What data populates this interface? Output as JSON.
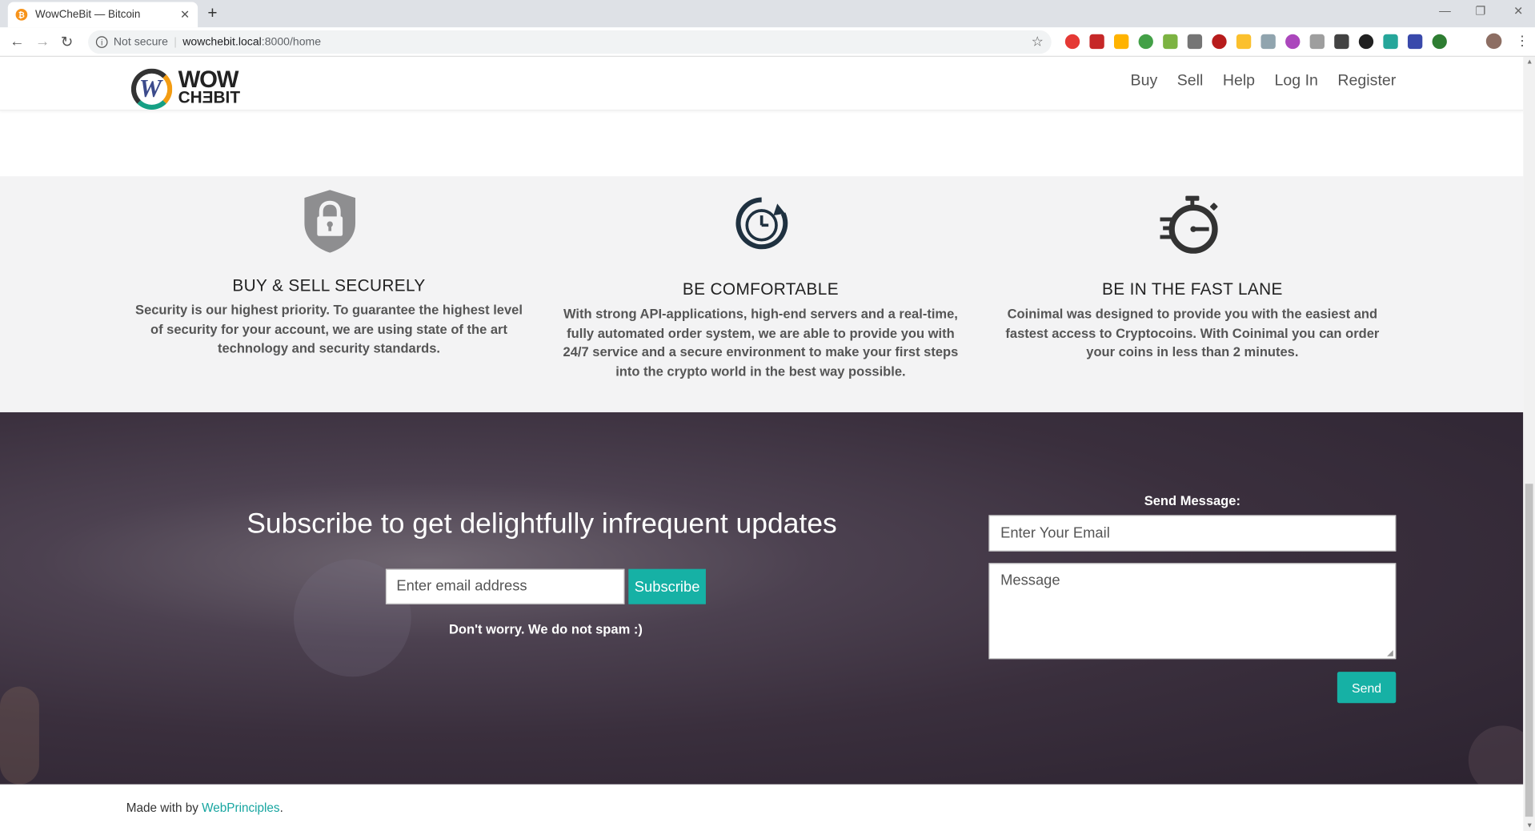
{
  "browser": {
    "tab_title": "WowCheBit — Bitcoin",
    "favicon": "₿",
    "close": "✕",
    "new_tab": "+",
    "minimize": "—",
    "restore": "❐",
    "close_window": "✕",
    "back": "←",
    "forward": "→",
    "reload": "↻",
    "not_secure": "Not secure",
    "separator": "|",
    "url_host": "wowchebit.local",
    "url_path": ":8000/home",
    "bookmark_star": "☆",
    "menu": "⋮",
    "extension_colors": [
      "#e53935",
      "#c62828",
      "#ffb300",
      "#43a047",
      "#7cb342",
      "#757575",
      "#b71c1c",
      "#fbc02d",
      "#90a4ae",
      "#ab47bc",
      "#9e9e9e",
      "#424242",
      "#212121",
      "#26a69a",
      "#3949ab",
      "#2e7d32"
    ]
  },
  "header": {
    "logo_w": "W",
    "logo_line1": "WOW",
    "logo_line2": "CHƎBIT",
    "nav": [
      "Buy",
      "Sell",
      "Help",
      "Log In",
      "Register"
    ]
  },
  "features": [
    {
      "icon": "padlock-shield-icon",
      "title": "BUY & SELL SECURELY",
      "text": "Security is our highest priority. To guarantee the highest level of security for your account, we are using state of the art technology and security standards."
    },
    {
      "icon": "stopwatch-refresh-icon",
      "title": "BE COMFORTABLE",
      "text": "With strong API-applications, high-end servers and a real-time, fully automated order system, we are able to provide you with 24/7 service and a secure environment to make your first steps into the crypto world in the best way possible."
    },
    {
      "icon": "fast-stopwatch-icon",
      "title": "BE IN THE FAST LANE",
      "text": "Coinimal was designed to provide you with the easiest and fastest access to Cryptocoins. With Coinimal you can order your coins in less than 2 minutes."
    }
  ],
  "subscribe": {
    "title": "Subscribe to get delightfully infrequent updates",
    "email_placeholder": "Enter email address",
    "button": "Subscribe",
    "note": "Don't worry. We do not spam :)"
  },
  "message": {
    "label": "Send Message:",
    "email_placeholder": "Enter Your Email",
    "message_placeholder": "Message",
    "button": "Send",
    "resize_grip": "◢"
  },
  "footer": {
    "prefix": "Made with by ",
    "link": "WebPrinciples",
    "suffix": "."
  },
  "colors": {
    "accent": "#16b1a5",
    "link": "#16a5a0",
    "features_bg": "#f3f3f4",
    "subscribe_bg": "#3a2f3d"
  }
}
